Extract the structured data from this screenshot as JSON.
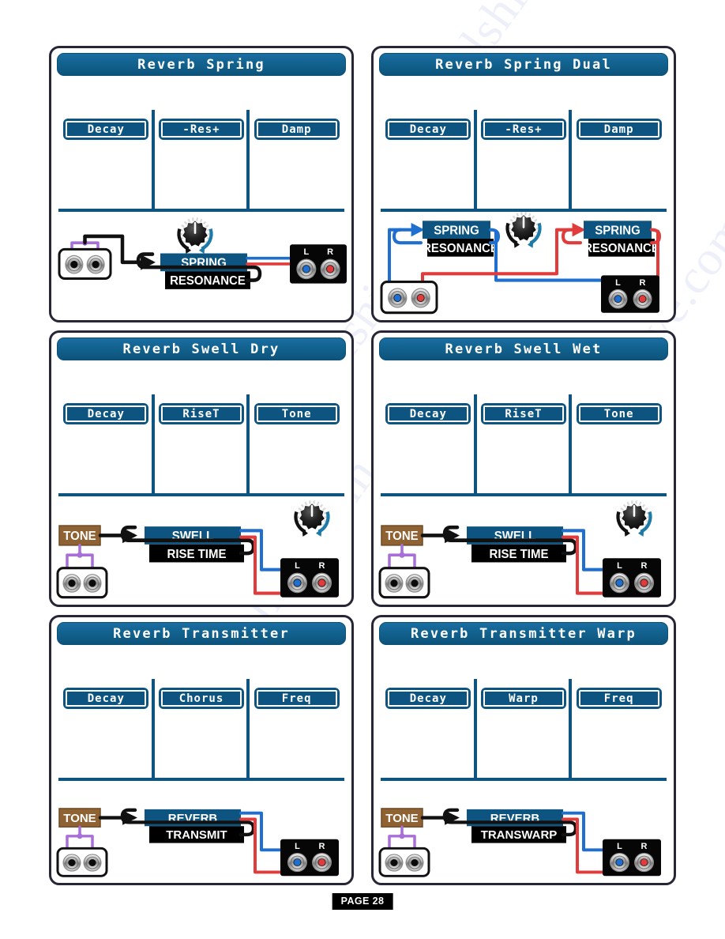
{
  "page": {
    "badge_label": "PAGE 28",
    "watermark_text": "manualshive.com"
  },
  "colors": {
    "lcd_blue": "#0d5580",
    "title_blue": "#12628f",
    "card_border": "#262636",
    "tone_brown": "#8f6234",
    "black_box": "#000000",
    "left_channel_blue": "#1f6fd0",
    "right_channel_red": "#e23b3b",
    "patch_purple": "#a96fd8",
    "knob_arc_blue": "#1e7aa8"
  },
  "cards": [
    {
      "title": "Reverb Spring",
      "params": [
        "Decay",
        "-Res+",
        "Damp"
      ],
      "diagram": {
        "layout": "single-mono",
        "knob": true,
        "input_jack": {
          "label": null,
          "left_color": "black",
          "right_color": "black",
          "style": "white"
        },
        "output_jack": {
          "left_label": "L",
          "right_label": "R",
          "left_color": "blue",
          "right_color": "red",
          "style": "black"
        },
        "blocks": [
          {
            "name": "effect-block",
            "top_label": "SPRING",
            "bottom_label": "RESONANCE"
          }
        ],
        "tone_block": null
      }
    },
    {
      "title": "Reverb Spring Dual",
      "params": [
        "Decay",
        "-Res+",
        "Damp"
      ],
      "diagram": {
        "layout": "dual-stereo",
        "knob": true,
        "input_jack": {
          "label": null,
          "left_color": "blue",
          "right_color": "red",
          "style": "white"
        },
        "output_jack": {
          "left_label": "L",
          "right_label": "R",
          "left_color": "blue",
          "right_color": "red",
          "style": "black"
        },
        "blocks": [
          {
            "name": "effect-block-left",
            "top_label": "SPRING",
            "bottom_label": "RESONANCE"
          },
          {
            "name": "effect-block-right",
            "top_label": "SPRING",
            "bottom_label": "RESONANCE"
          }
        ],
        "tone_block": null
      }
    },
    {
      "title": "Reverb Swell Dry",
      "params": [
        "Decay",
        "RiseT",
        "Tone"
      ],
      "diagram": {
        "layout": "tone-mono",
        "knob": true,
        "input_jack": {
          "label": null,
          "left_color": "black",
          "right_color": "black",
          "style": "white"
        },
        "output_jack": {
          "left_label": "L",
          "right_label": "R",
          "left_color": "blue",
          "right_color": "red",
          "style": "black"
        },
        "blocks": [
          {
            "name": "effect-block",
            "top_label": "SWELL",
            "bottom_label": "RISE TIME"
          }
        ],
        "tone_block": {
          "label": "TONE"
        }
      }
    },
    {
      "title": "Reverb Swell Wet",
      "params": [
        "Decay",
        "RiseT",
        "Tone"
      ],
      "diagram": {
        "layout": "tone-mono",
        "knob": true,
        "input_jack": {
          "label": null,
          "left_color": "black",
          "right_color": "black",
          "style": "white"
        },
        "output_jack": {
          "left_label": "L",
          "right_label": "R",
          "left_color": "blue",
          "right_color": "red",
          "style": "black"
        },
        "blocks": [
          {
            "name": "effect-block",
            "top_label": "SWELL",
            "bottom_label": "RISE TIME"
          }
        ],
        "tone_block": {
          "label": "TONE"
        }
      }
    },
    {
      "title": "Reverb Transmitter",
      "params": [
        "Decay",
        "Chorus",
        "Freq"
      ],
      "diagram": {
        "layout": "tone-mono-noknob",
        "knob": false,
        "input_jack": {
          "label": null,
          "left_color": "black",
          "right_color": "black",
          "style": "white"
        },
        "output_jack": {
          "left_label": "L",
          "right_label": "R",
          "left_color": "blue",
          "right_color": "red",
          "style": "black"
        },
        "blocks": [
          {
            "name": "effect-block",
            "top_label": "REVERB",
            "bottom_label": "TRANSMIT"
          }
        ],
        "tone_block": {
          "label": "TONE"
        }
      }
    },
    {
      "title": "Reverb Transmitter Warp",
      "params": [
        "Decay",
        "Warp",
        "Freq"
      ],
      "diagram": {
        "layout": "tone-mono-noknob",
        "knob": false,
        "input_jack": {
          "label": null,
          "left_color": "black",
          "right_color": "black",
          "style": "white"
        },
        "output_jack": {
          "left_label": "L",
          "right_label": "R",
          "left_color": "blue",
          "right_color": "red",
          "style": "black"
        },
        "blocks": [
          {
            "name": "effect-block",
            "top_label": "REVERB",
            "bottom_label": "TRANSWARP"
          }
        ],
        "tone_block": {
          "label": "TONE"
        }
      }
    }
  ]
}
